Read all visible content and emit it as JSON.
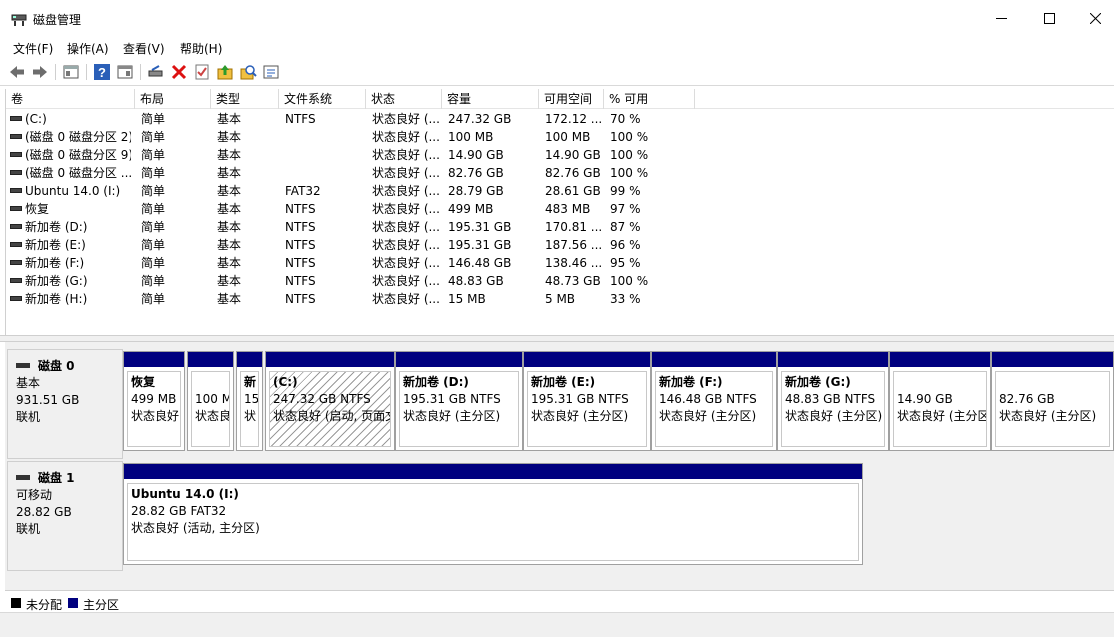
{
  "window": {
    "title": "磁盘管理"
  },
  "menu": [
    "文件(F)",
    "操作(A)",
    "查看(V)",
    "帮助(H)"
  ],
  "toolbar": [
    "back-icon",
    "forward-icon",
    "properties-icon",
    "help-icon",
    "console-icon",
    "connect-drive-icon",
    "delete-icon",
    "check-icon",
    "up-icon",
    "search-icon",
    "settings-icon"
  ],
  "volume_table": {
    "columns": [
      "卷",
      "布局",
      "类型",
      "文件系统",
      "状态",
      "容量",
      "可用空间",
      "% 可用"
    ],
    "rows": [
      [
        "(C:)",
        "简单",
        "基本",
        "NTFS",
        "状态良好 (...",
        "247.32 GB",
        "172.12 ...",
        "70 %"
      ],
      [
        "(磁盘 0 磁盘分区 2)",
        "简单",
        "基本",
        "",
        "状态良好 (...",
        "100 MB",
        "100 MB",
        "100 %"
      ],
      [
        "(磁盘 0 磁盘分区 9)",
        "简单",
        "基本",
        "",
        "状态良好 (...",
        "14.90 GB",
        "14.90 GB",
        "100 %"
      ],
      [
        "(磁盘 0 磁盘分区 ...",
        "简单",
        "基本",
        "",
        "状态良好 (...",
        "82.76 GB",
        "82.76 GB",
        "100 %"
      ],
      [
        "Ubuntu 14.0 (I:)",
        "简单",
        "基本",
        "FAT32",
        "状态良好 (...",
        "28.79 GB",
        "28.61 GB",
        "99 %"
      ],
      [
        "恢复",
        "简单",
        "基本",
        "NTFS",
        "状态良好 (...",
        "499 MB",
        "483 MB",
        "97 %"
      ],
      [
        "新加卷 (D:)",
        "简单",
        "基本",
        "NTFS",
        "状态良好 (...",
        "195.31 GB",
        "170.81 ...",
        "87 %"
      ],
      [
        "新加卷 (E:)",
        "简单",
        "基本",
        "NTFS",
        "状态良好 (...",
        "195.31 GB",
        "187.56 ...",
        "96 %"
      ],
      [
        "新加卷 (F:)",
        "简单",
        "基本",
        "NTFS",
        "状态良好 (...",
        "146.48 GB",
        "138.46 ...",
        "95 %"
      ],
      [
        "新加卷 (G:)",
        "简单",
        "基本",
        "NTFS",
        "状态良好 (...",
        "48.83 GB",
        "48.73 GB",
        "100 %"
      ],
      [
        "新加卷 (H:)",
        "简单",
        "基本",
        "NTFS",
        "状态良好 (...",
        "15 MB",
        "5 MB",
        "33 %"
      ]
    ]
  },
  "disks": [
    {
      "name": "磁盘 0",
      "type": "基本",
      "size": "931.51 GB",
      "status": "联机",
      "partitions": [
        {
          "name": "恢复",
          "size": "499 MB",
          "status": "状态良好"
        },
        {
          "name": "",
          "size": "100 M",
          "status": "状态良"
        },
        {
          "name": "新",
          "size": "15",
          "status": "状"
        },
        {
          "name": "(C:)",
          "size": "247.32 GB NTFS",
          "status": "状态良好 (启动, 页面文"
        },
        {
          "name": "新加卷  (D:)",
          "size": "195.31 GB NTFS",
          "status": "状态良好 (主分区)"
        },
        {
          "name": "新加卷  (E:)",
          "size": "195.31 GB NTFS",
          "status": "状态良好 (主分区)"
        },
        {
          "name": "新加卷  (F:)",
          "size": "146.48 GB NTFS",
          "status": "状态良好 (主分区)"
        },
        {
          "name": "新加卷  (G:)",
          "size": "48.83 GB NTFS",
          "status": "状态良好 (主分区)"
        },
        {
          "name": "",
          "size": "14.90 GB",
          "status": "状态良好 (主分区"
        },
        {
          "name": "",
          "size": "82.76 GB",
          "status": "状态良好 (主分区)"
        }
      ]
    },
    {
      "name": "磁盘 1",
      "type": "可移动",
      "size": "28.82 GB",
      "status": "联机",
      "partitions": [
        {
          "name": "Ubuntu 14.0  (I:)",
          "size": "28.82 GB FAT32",
          "status": "状态良好 (活动, 主分区)"
        }
      ]
    }
  ],
  "legend": [
    {
      "label": "未分配",
      "color": "#000000"
    },
    {
      "label": "主分区",
      "color": "#00007f"
    }
  ]
}
